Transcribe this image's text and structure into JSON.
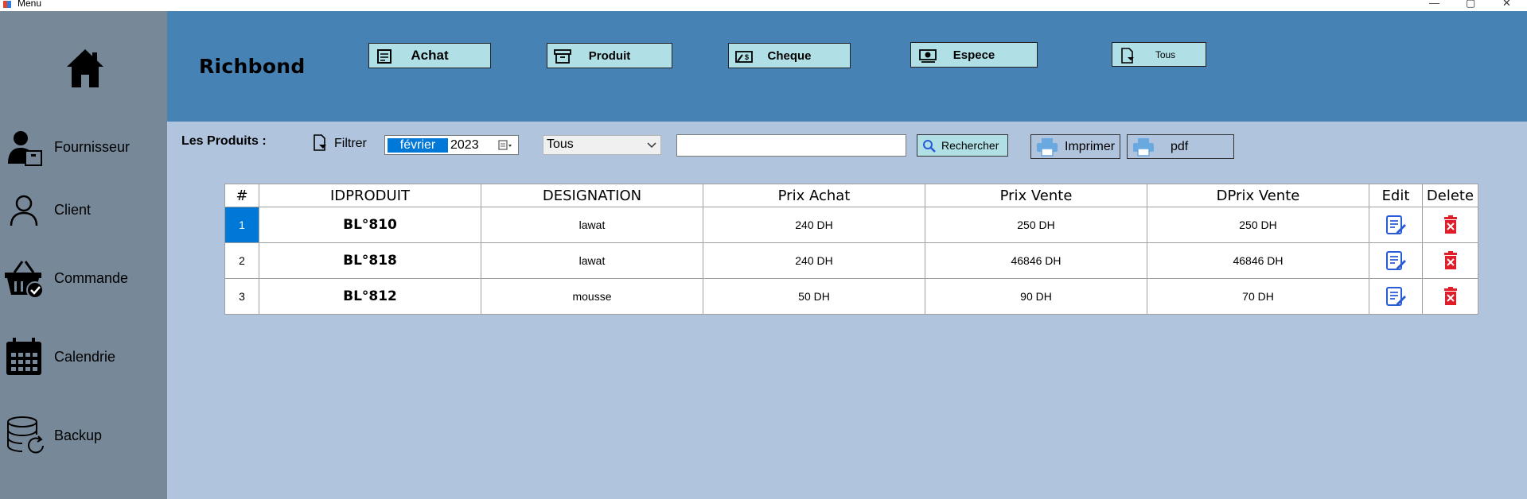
{
  "window": {
    "title": "Menu",
    "controls": [
      "—",
      "▢",
      "✕"
    ]
  },
  "sidebar": {
    "items": [
      {
        "label": "Fournisseur",
        "icon": "supplier-icon"
      },
      {
        "label": "Client",
        "icon": "user-icon"
      },
      {
        "label": "Commande",
        "icon": "basket-icon"
      },
      {
        "label": "Calendrie",
        "icon": "calendar-icon"
      },
      {
        "label": "Backup",
        "icon": "database-backup-icon"
      }
    ]
  },
  "header": {
    "brand": "Richbond",
    "buttons": [
      {
        "label": "Achat",
        "icon": "receipt-icon"
      },
      {
        "label": "Produit",
        "icon": "archive-box-icon"
      },
      {
        "label": "Cheque",
        "icon": "cheque-icon"
      },
      {
        "label": "Espece",
        "icon": "cash-icon"
      },
      {
        "label": "Tous",
        "icon": "document-filter-icon"
      }
    ]
  },
  "toolbar": {
    "section_label": "Les Produits :",
    "filter_label": "Filtrer",
    "date_month": "février",
    "date_year": "2023",
    "combo_value": "Tous",
    "search_value": "",
    "search_button": "Rechercher",
    "print_button": "Imprimer",
    "pdf_button": "pdf"
  },
  "table": {
    "columns": [
      "#",
      "IDPRODUIT",
      "DESIGNATION",
      "Prix Achat",
      "Prix Vente",
      "DPrix Vente",
      "Edit",
      "Delete"
    ],
    "rows": [
      {
        "num": "1",
        "id": "BL°810",
        "designation": "lawat",
        "prix_achat": "240 DH",
        "prix_vente": "250 DH",
        "dprix_vente": "250 DH",
        "selected": true
      },
      {
        "num": "2",
        "id": "BL°818",
        "designation": "lawat",
        "prix_achat": "240 DH",
        "prix_vente": "46846 DH",
        "dprix_vente": "46846 DH",
        "selected": false
      },
      {
        "num": "3",
        "id": "BL°812",
        "designation": "mousse",
        "prix_achat": "50 DH",
        "prix_vente": "90 DH",
        "dprix_vente": "70 DH",
        "selected": false
      }
    ]
  },
  "colors": {
    "sidebar": "#778899",
    "header": "#4682b4",
    "content": "#b0c4de",
    "button": "#b0e0e6",
    "selection": "#0078d7",
    "delete": "#e01e2a",
    "edit": "#2a5bd7"
  }
}
